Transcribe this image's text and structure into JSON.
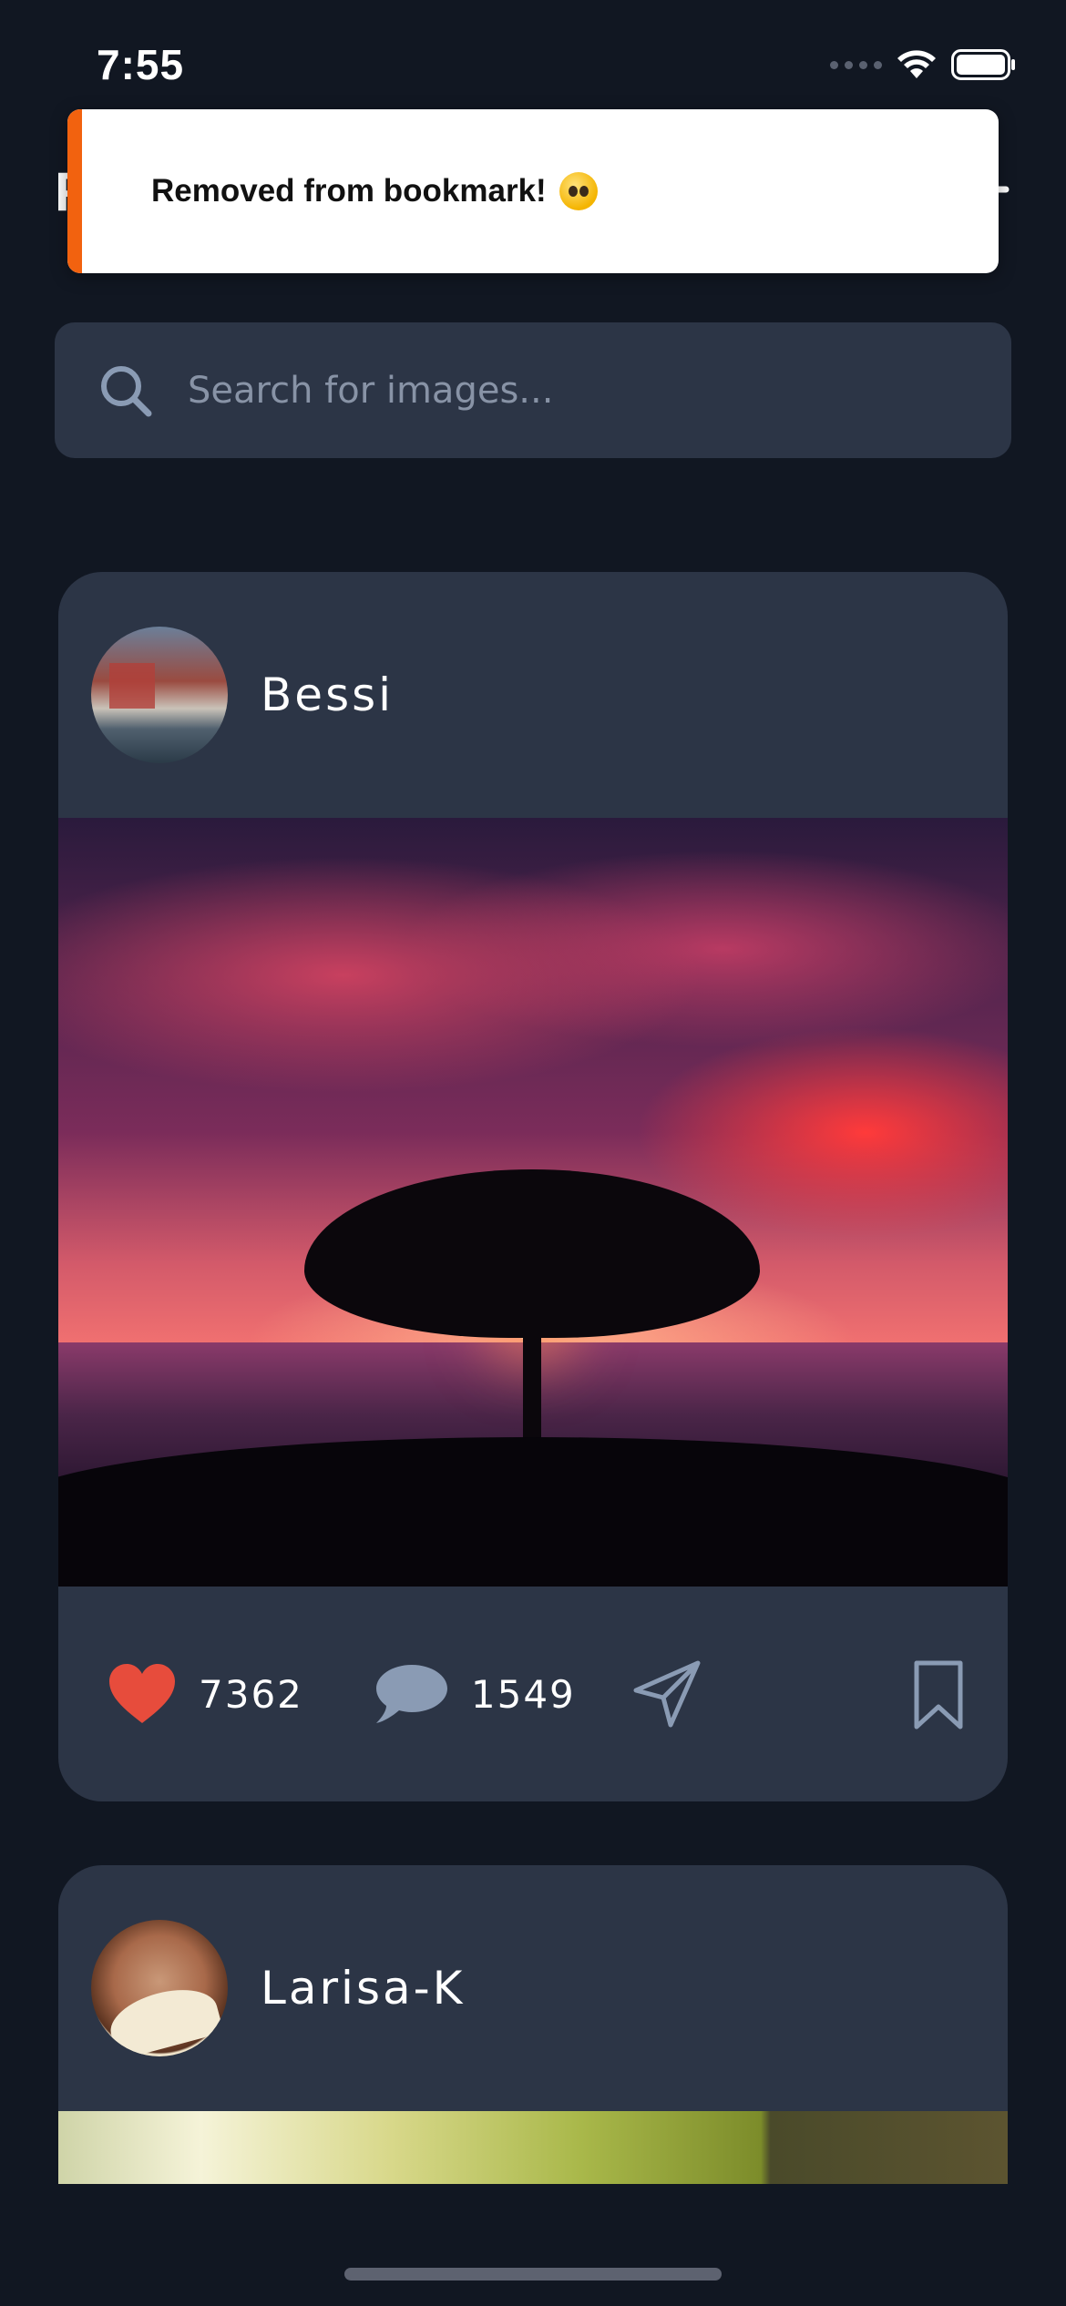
{
  "status_bar": {
    "time": "7:55"
  },
  "header": {
    "title": "F"
  },
  "toast": {
    "message": "Removed from bookmark!",
    "accent_color": "#f2620f",
    "emoji_icon": "pleading-face-icon"
  },
  "search": {
    "placeholder": "Search for images..."
  },
  "posts": [
    {
      "username": "Bessi",
      "likes": "7362",
      "comments": "1549",
      "liked": true,
      "bookmarked": false
    },
    {
      "username": "Larisa-K"
    }
  ],
  "colors": {
    "background": "#111722",
    "card": "#2c3546",
    "heart": "#e74c3c",
    "icon_muted": "#8a9bb4"
  }
}
